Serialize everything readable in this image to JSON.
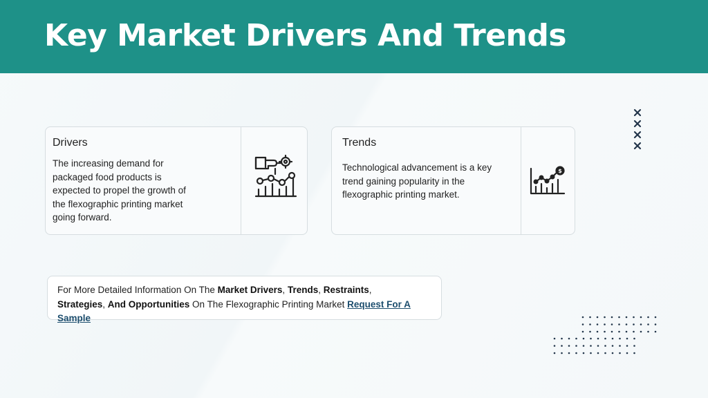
{
  "header": {
    "title": "Key Market Drivers And Trends"
  },
  "drivers_card": {
    "title": "Drivers",
    "body": "The increasing demand for packaged food products is expected to propel the growth of the flexographic printing market going forward.",
    "icon": "hand-gear-chart-icon"
  },
  "trends_card": {
    "title": "Trends",
    "body": "Technological advancement is a key trend gaining popularity in the flexographic printing market.",
    "icon": "dollar-growth-chart-icon"
  },
  "info": {
    "prefix": "For More Detailed Information On The ",
    "market_drivers": "Market Drivers",
    "sep1": ", ",
    "trends": "Trends",
    "sep2": ", ",
    "restraints": "Restraints",
    "sep3": ", ",
    "strategies": "Strategies",
    "sep4": ", ",
    "and_opportunities": "And Opportunities",
    "suffix": " On The Flexographic Printing Market  ",
    "link_label": "Request For A Sample"
  },
  "decor": {
    "x_icon": "close-icon",
    "accent": "#1e9188",
    "dark": "#22354a"
  }
}
